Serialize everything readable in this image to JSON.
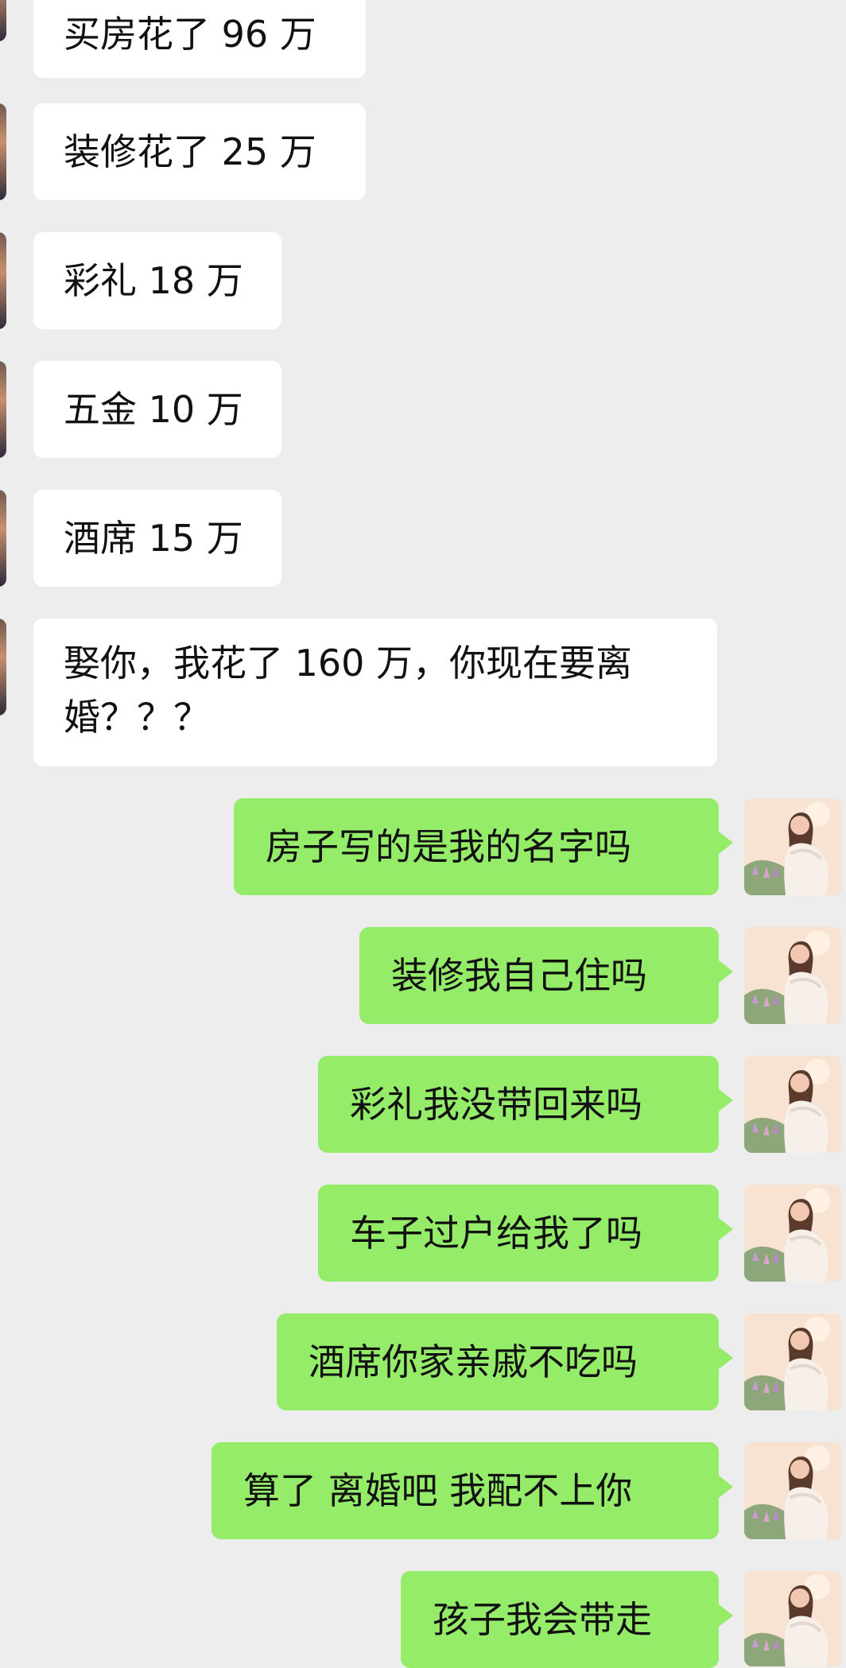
{
  "chat": {
    "incoming": [
      {
        "text": "买房花了 96 万"
      },
      {
        "text": "装修花了 25 万"
      },
      {
        "text": "彩礼 18 万"
      },
      {
        "text": "五金 10 万"
      },
      {
        "text": "酒席 15 万"
      },
      {
        "text": "娶你，我花了 160 万，你现在要离婚？？？"
      }
    ],
    "outgoing": [
      {
        "text": "房子写的是我的名字吗"
      },
      {
        "text": "装修我自己住吗"
      },
      {
        "text": "彩礼我没带回来吗"
      },
      {
        "text": "车子过户给我了吗"
      },
      {
        "text": "酒席你家亲戚不吃吗"
      },
      {
        "text": "算了 离婚吧 我配不上你"
      },
      {
        "text": "孩子我会带走"
      }
    ]
  },
  "colors": {
    "background": "#ededed",
    "incoming_bubble": "#ffffff",
    "outgoing_bubble": "#95ec69"
  },
  "icons": {
    "left_avatar": "contact-avatar-icon",
    "right_avatar": "user-avatar-icon"
  }
}
